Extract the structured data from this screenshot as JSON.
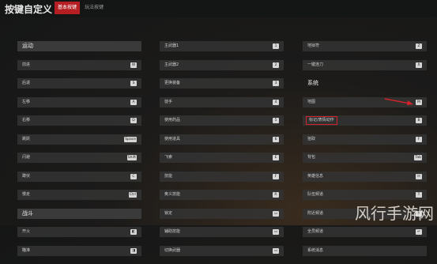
{
  "window": {
    "title": "按键自定义"
  },
  "tabs": [
    {
      "label": "基本按键",
      "active": true
    },
    {
      "label": "玩法按键",
      "active": false
    }
  ],
  "col1": {
    "sections": [
      {
        "title": "运动",
        "rows": [
          {
            "label": "前进",
            "key": "W"
          },
          {
            "label": "后退",
            "key": "S"
          },
          {
            "label": "左移",
            "key": "A"
          },
          {
            "label": "右移",
            "key": "D"
          },
          {
            "label": "跳跃",
            "key": "Space"
          },
          {
            "label": "闪避",
            "key": "Shift"
          },
          {
            "label": "蹲伏",
            "key": "C"
          },
          {
            "label": "慢走",
            "key": "Ctrl"
          }
        ]
      },
      {
        "title": "战斗",
        "rows": [
          {
            "label": "开火",
            "key": ""
          },
          {
            "label": "瞄准",
            "key": ""
          }
        ]
      }
    ]
  },
  "col2": {
    "rows": [
      {
        "label": "主武器1",
        "key": "1"
      },
      {
        "label": "主武器2",
        "key": "2"
      },
      {
        "label": "更换装备",
        "key": "3"
      },
      {
        "label": "徒手",
        "key": "4"
      },
      {
        "label": "使用药品",
        "key": "5"
      },
      {
        "label": "使用道具",
        "key": "6"
      },
      {
        "label": "飞索",
        "key": "E"
      },
      {
        "label": "技能",
        "key": "F"
      },
      {
        "label": "奥义技能",
        "key": "R"
      },
      {
        "label": "锁定",
        "key": ""
      },
      {
        "label": "辅助技能",
        "key": ""
      },
      {
        "label": "切换武器",
        "key": ""
      }
    ]
  },
  "col3": {
    "rows_top": [
      {
        "label": "地狱符",
        "key": "Z"
      },
      {
        "label": "一键连刀",
        "key": "X"
      }
    ],
    "section": {
      "title": "系统",
      "rows": [
        {
          "label": "地图",
          "key": "M"
        },
        {
          "label": "标记/表情动作",
          "key": "B",
          "highlighted": true
        },
        {
          "label": "拾取",
          "key": "F"
        },
        {
          "label": "背包",
          "key": "Tab"
        },
        {
          "label": "英雄信息",
          "key": "H"
        },
        {
          "label": "队伍频道",
          "key": "T"
        },
        {
          "label": "附近频道",
          "key": "Y"
        },
        {
          "label": "全员频道",
          "key": ""
        },
        {
          "label": "系统消息",
          "key": ""
        }
      ]
    }
  },
  "watermark": {
    "text": "风行手游网"
  },
  "colors": {
    "accent": "#b51f23",
    "highlight": "#d2232a"
  }
}
